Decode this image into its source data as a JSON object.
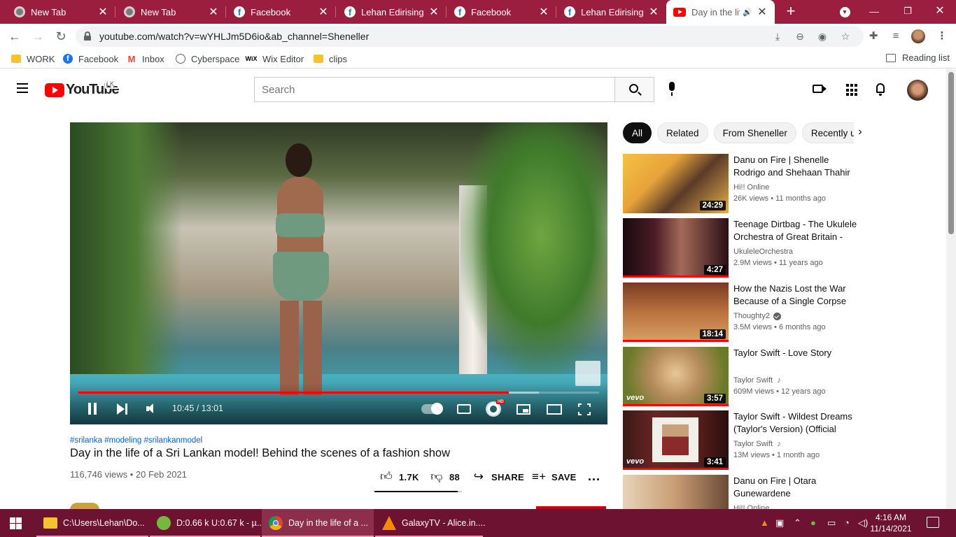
{
  "browser": {
    "tabs": [
      {
        "title": "New Tab",
        "icon": "chrome-icon"
      },
      {
        "title": "New Tab",
        "icon": "chrome-icon"
      },
      {
        "title": "Facebook",
        "icon": "facebook-icon"
      },
      {
        "title": "Lehan Edirisinghe",
        "icon": "facebook-icon"
      },
      {
        "title": "Facebook",
        "icon": "facebook-icon"
      },
      {
        "title": "Lehan Edirisinghe",
        "icon": "facebook-icon"
      },
      {
        "title": "Day in the life of a Sri Lankan model!",
        "icon": "youtube-icon",
        "active": true
      }
    ],
    "close_glyph": "✕",
    "new_tab_glyph": "+",
    "url": "youtube.com/watch?v=wYHLJm5D6io&ab_channel=Sheneller",
    "bookmarks": [
      {
        "label": "WORK",
        "icon": "folder-icon"
      },
      {
        "label": "Facebook",
        "icon": "facebook-icon"
      },
      {
        "label": "Inbox",
        "icon": "gmail-icon"
      },
      {
        "label": "Cyberspace",
        "icon": "cyberspace-icon"
      },
      {
        "label": "Wix Editor",
        "icon": "wix-icon"
      },
      {
        "label": "clips",
        "icon": "folder-icon"
      }
    ],
    "reading_list": "Reading list"
  },
  "youtube": {
    "logo_text": "YouTube",
    "country_code": "LK",
    "search_placeholder": "Search",
    "player": {
      "current_time": "10:45",
      "duration": "13:01",
      "time_display": "10:45 / 13:01",
      "played_fraction": 0.826,
      "buffered_fraction": 0.885,
      "hd_badge": "HD"
    },
    "video": {
      "hashtags": "#srilanka #modeling #srilankanmodel",
      "title": "Day in the life of a Sri Lankan model! Behind the scenes of a fashion show",
      "meta": "116,746 views • 20 Feb 2021",
      "likes": "1.7K",
      "dislikes": "88",
      "like_fraction": 0.95,
      "share_label": "SHARE",
      "save_label": "SAVE",
      "more_label": "..."
    },
    "chips": [
      "All",
      "Related",
      "From Sheneller",
      "Recently uploaded"
    ],
    "related": [
      {
        "title": "Danu on Fire | Shenelle Rodrigo and Shehaan Thahir",
        "channel": "Hi!! Online",
        "stats": "26K views • 11 months ago",
        "duration": "24:29",
        "verified": false,
        "music": false,
        "watched": false,
        "vevo": false
      },
      {
        "title": "Teenage Dirtbag - The Ukulele Orchestra of Great Britain - BBC Four",
        "channel": "UkuleleOrchestra",
        "stats": "2.9M views • 11 years ago",
        "duration": "4:27",
        "verified": false,
        "music": false,
        "watched": true,
        "vevo": false
      },
      {
        "title": "How the Nazis Lost the War Because of a Single Corpse",
        "channel": "Thoughty2",
        "stats": "3.5M views • 6 months ago",
        "duration": "18:14",
        "verified": true,
        "music": false,
        "watched": true,
        "vevo": false
      },
      {
        "title": "Taylor Swift - Love Story",
        "channel": "Taylor Swift",
        "stats": "609M views • 12 years ago",
        "duration": "3:57",
        "verified": false,
        "music": true,
        "watched": true,
        "vevo": true
      },
      {
        "title": "Taylor Swift - Wildest Dreams (Taylor's Version) (Official Audio)",
        "channel": "Taylor Swift",
        "stats": "13M views • 1 month ago",
        "duration": "3:41",
        "verified": false,
        "music": true,
        "watched": true,
        "vevo": true
      },
      {
        "title": "Danu on Fire | Otara Gunewardene",
        "channel": "Hi!! Online",
        "stats": "",
        "duration": "",
        "verified": false,
        "music": false,
        "watched": false,
        "vevo": false
      }
    ],
    "vevo_label": "vevo",
    "music_glyph": "♪"
  },
  "taskbar": {
    "items": [
      {
        "label": "C:\\Users\\Lehan\\Do...",
        "icon": "file-explorer-icon"
      },
      {
        "label": "D:0.66 k U:0.67 k - µ...",
        "icon": "utorrent-icon"
      },
      {
        "label": "Day in the life of a ...",
        "icon": "chrome-icon",
        "active": true
      },
      {
        "label": "GalaxyTV - Alice.in....",
        "icon": "vlc-icon"
      }
    ],
    "time": "4:16 AM",
    "date": "11/14/2021"
  },
  "colors": {
    "tabstrip": "#9c1e3e",
    "taskbar": "#6d1230",
    "youtube_red": "#ff0000",
    "link_blue": "#065fd4"
  }
}
